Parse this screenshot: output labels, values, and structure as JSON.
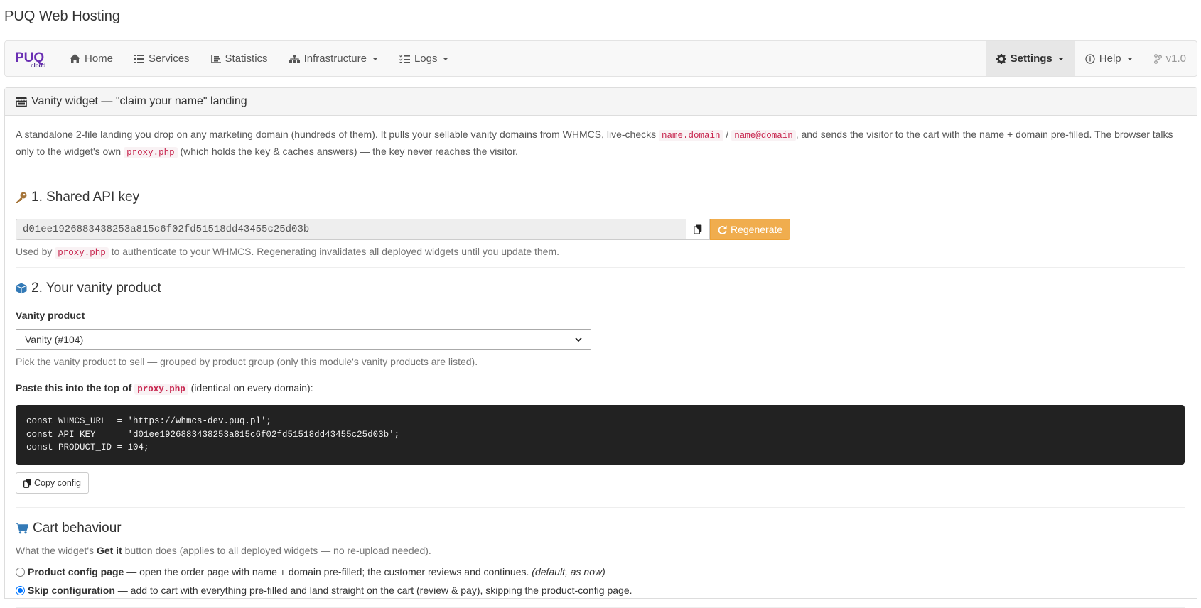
{
  "app": {
    "title": "PUQ Web Hosting"
  },
  "navbar": {
    "brand_main": "PUQ",
    "brand_sub": "cloud",
    "items": [
      {
        "label": "Home",
        "icon": "home-icon"
      },
      {
        "label": "Services",
        "icon": "list-icon"
      },
      {
        "label": "Statistics",
        "icon": "chart-icon"
      },
      {
        "label": "Infrastructure",
        "icon": "sitemap-icon"
      },
      {
        "label": "Logs",
        "icon": "tasks-icon"
      }
    ],
    "right_items": [
      {
        "label": "Settings",
        "icon": "gear-icon"
      },
      {
        "label": "Help",
        "icon": "info-icon"
      },
      {
        "label": "v1.0",
        "icon": "branch-icon"
      }
    ]
  },
  "panel": {
    "title": "Vanity widget — \"claim your name\" landing",
    "intro": {
      "p1": "A standalone 2-file landing you drop on any marketing domain (hundreds of them). It pulls your sellable vanity domains from WHMCS, live-checks ",
      "code1": "name.domain",
      "sep": " / ",
      "code2": "name@domain",
      "p2": ", and sends the visitor to the cart with the name + domain pre-filled. The browser talks only to the widget's own ",
      "code3": "proxy.php",
      "p3": " (which holds the key & caches answers) — the key never reaches the visitor."
    },
    "api_key": {
      "heading": "1. Shared API key",
      "value": "d01ee1926883438253a815c6f02fd51518dd43455c25d03b",
      "regenerate_label": "Regenerate",
      "help_pre": "Used by ",
      "help_code": "proxy.php",
      "help_post": " to authenticate to your WHMCS. Regenerating invalidates all deployed widgets until you update them."
    },
    "vanity": {
      "heading": "2. Your vanity product",
      "label": "Vanity product",
      "selected": "Vanity (#104)",
      "help": "Pick the vanity product to sell — grouped by product group (only this module's vanity products are listed).",
      "paste_pre": "Paste this into the top of ",
      "paste_code": "proxy.php",
      "paste_post": " (identical on every domain):",
      "config": "const WHMCS_URL  = 'https://whmcs-dev.puq.pl';\nconst API_KEY    = 'd01ee1926883438253a815c6f02fd51518dd43455c25d03b';\nconst PRODUCT_ID = 104;",
      "copy_label": "Copy config"
    },
    "cart": {
      "heading": "Cart behaviour",
      "desc_pre": "What the widget's ",
      "desc_bold": "Get it",
      "desc_post": " button does (applies to all deployed widgets — no re-upload needed).",
      "options": [
        {
          "title": "Product config page",
          "desc": " — open the order page with name + domain pre-filled; the customer reviews and continues. ",
          "note": "(default, as now)",
          "checked": false
        },
        {
          "title": "Skip configuration",
          "desc": " — add to cart with everything pre-filled and land straight on the cart (review & pay), skipping the product-config page.",
          "note": "",
          "checked": true
        }
      ]
    }
  },
  "colors": {
    "brand_purple": "#6a2fb3",
    "warning": "#f0ad4e",
    "code_red": "#c7254e",
    "icon_blue": "#337ab7",
    "key_brown": "#a5753a"
  }
}
